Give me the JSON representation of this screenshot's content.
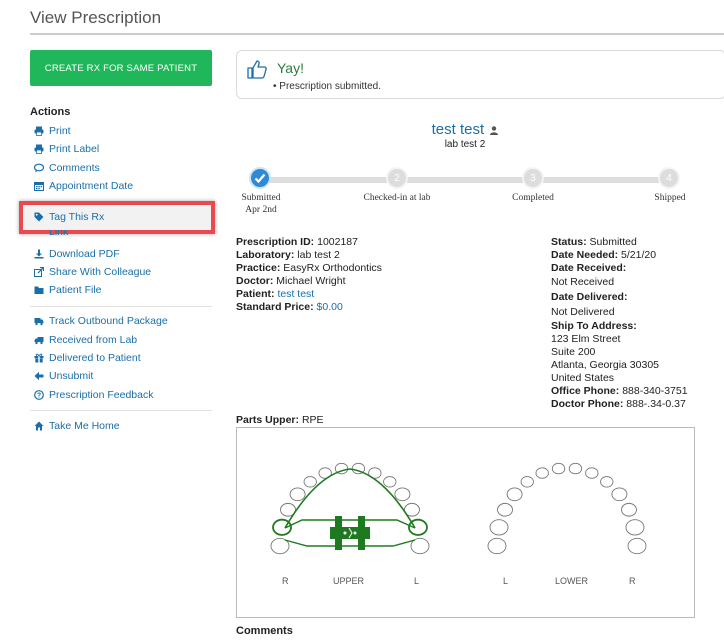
{
  "page": {
    "title": "View Prescription"
  },
  "create_button": "CREATE RX FOR SAME PATIENT",
  "actions": {
    "title": "Actions",
    "group1": [
      {
        "label": "Print",
        "icon": "print-icon"
      },
      {
        "label": "Print Label",
        "icon": "print-icon"
      },
      {
        "label": "Comments",
        "icon": "comments-icon"
      },
      {
        "label": "Appointment Date",
        "icon": "calendar-icon"
      },
      {
        "label": "Tag This Rx",
        "icon": "tag-icon"
      },
      {
        "label": "Link",
        "icon": "link-icon"
      },
      {
        "label": "Download PDF",
        "icon": "download-icon"
      },
      {
        "label": "Share With Colleague",
        "icon": "share-icon"
      },
      {
        "label": "Patient File",
        "icon": "folder-icon"
      }
    ],
    "group2": [
      {
        "label": "Track Outbound Package",
        "icon": "truck-icon"
      },
      {
        "label": "Received from Lab",
        "icon": "truck-icon"
      },
      {
        "label": "Delivered to Patient",
        "icon": "gift-icon"
      },
      {
        "label": "Unsubmit",
        "icon": "arrow-left-icon"
      },
      {
        "label": "Prescription Feedback",
        "icon": "question-icon"
      }
    ],
    "group3": [
      {
        "label": "Take Me Home",
        "icon": "home-icon"
      }
    ]
  },
  "alert": {
    "title": "Yay!",
    "message": "• Prescription submitted."
  },
  "patient": {
    "name": "test test",
    "lab": "lab test 2"
  },
  "progress": {
    "steps": [
      {
        "number": "1",
        "label": "Submitted",
        "sub": "Apr 2nd",
        "done": true
      },
      {
        "number": "2",
        "label": "Checked-in at lab",
        "sub": "",
        "done": false
      },
      {
        "number": "3",
        "label": "Completed",
        "sub": "",
        "done": false
      },
      {
        "number": "4",
        "label": "Shipped",
        "sub": "",
        "done": false
      }
    ]
  },
  "details_left": {
    "prescription_id_label": "Prescription ID:",
    "prescription_id": "1002187",
    "laboratory_label": "Laboratory:",
    "laboratory": "lab test 2",
    "practice_label": "Practice:",
    "practice": "EasyRx Orthodontics",
    "doctor_label": "Doctor:",
    "doctor": "Michael Wright",
    "patient_label": "Patient:",
    "patient": "test test",
    "price_label": "Standard Price:",
    "price": "$0.00"
  },
  "details_right": {
    "status_label": "Status:",
    "status": "Submitted",
    "date_needed_label": "Date Needed:",
    "date_needed": "5/21/20",
    "date_received_label": "Date Received:",
    "date_received": "Not Received",
    "date_delivered_label": "Date Delivered:",
    "date_delivered": "Not Delivered",
    "ship_to_label": "Ship To Address:",
    "address1": "123 Elm Street",
    "address2": "Suite 200",
    "address3": "Atlanta, Georgia 30305",
    "address4": "United States",
    "office_phone_label": "Office Phone:",
    "office_phone": "888-340-3751",
    "doctor_phone_label": "Doctor Phone:",
    "doctor_phone": "888-.34-0.37"
  },
  "parts": {
    "label": "Parts Upper:",
    "value": "RPE"
  },
  "diagram": {
    "upper_label": "UPPER",
    "lower_label": "LOWER",
    "r": "R",
    "l": "L",
    "highlight_color": "#1e7a1e"
  },
  "comments": {
    "title": "Comments"
  },
  "colors": {
    "green_button": "#20b75a",
    "link": "#1a6fa8",
    "highlight_border": "#ea4a4f",
    "step_done": "#2f8ad4"
  }
}
